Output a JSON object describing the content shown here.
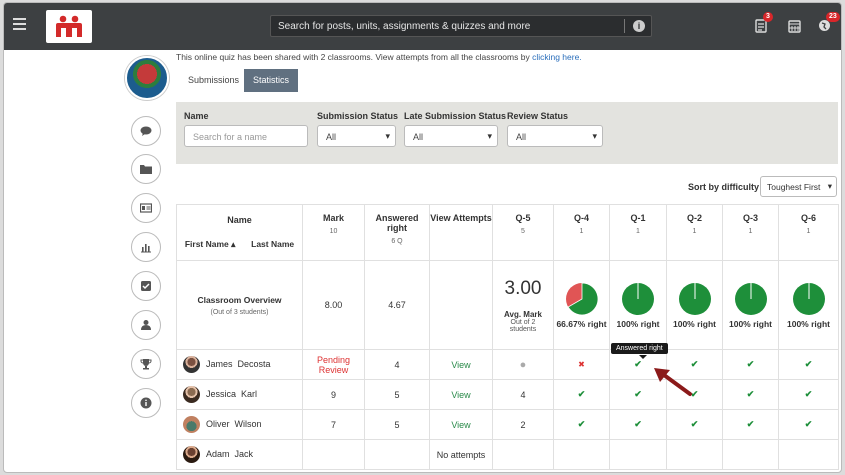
{
  "header": {
    "search_placeholder": "Search for posts, units, assignments & quizzes and more",
    "badges": {
      "notes": "3",
      "notifications": "23"
    }
  },
  "share_text": "This online quiz has been shared with 2 classrooms. View attempts from all the classrooms by ",
  "share_link": "clicking here.",
  "tabs": [
    "Submissions",
    "Statistics"
  ],
  "filters": {
    "name_label": "Name",
    "name_placeholder": "Search for a name",
    "submission_label": "Submission Status",
    "submission_value": "All",
    "late_label": "Late Submission Status",
    "late_value": "All",
    "review_label": "Review Status",
    "review_value": "All"
  },
  "sort": {
    "label": "Sort by difficulty",
    "value": "Toughest First"
  },
  "table": {
    "name_header": "Name",
    "first_name": "First Name",
    "last_name": "Last Name",
    "mark_header": "Mark",
    "mark_sub": "10",
    "answered_header": "Answered right",
    "answered_sub": "6 Q",
    "view_header": "View Attempts",
    "questions": [
      {
        "label": "Q-5",
        "sub": "5"
      },
      {
        "label": "Q-4",
        "sub": "1"
      },
      {
        "label": "Q-1",
        "sub": "1"
      },
      {
        "label": "Q-2",
        "sub": "1"
      },
      {
        "label": "Q-3",
        "sub": "1"
      },
      {
        "label": "Q-6",
        "sub": "1"
      }
    ],
    "overview": {
      "title": "Classroom Overview",
      "subtitle": "(Out of 3 students)",
      "mark": "8.00",
      "answered": "4.67",
      "avg_value": "3.00",
      "avg_label": "Avg. Mark",
      "avg_sub": "Out of 2 students",
      "pies": [
        {
          "label": "66.67% right",
          "pct": 66.67
        },
        {
          "label": "100% right",
          "pct": 100
        },
        {
          "label": "100% right",
          "pct": 100
        },
        {
          "label": "100% right",
          "pct": 100
        },
        {
          "label": "100% right",
          "pct": 100
        }
      ]
    },
    "rows": [
      {
        "first": "James",
        "last": "Decosta",
        "mark": "Pending Review",
        "answered": "4",
        "view": "View",
        "q5": "●",
        "marks": [
          "✖",
          "✔",
          "✔",
          "✔",
          "✔"
        ]
      },
      {
        "first": "Jessica",
        "last": "Karl",
        "mark": "9",
        "answered": "5",
        "view": "View",
        "q5": "4",
        "marks": [
          "✔",
          "✔",
          "✔",
          "✔",
          "✔"
        ]
      },
      {
        "first": "Oliver",
        "last": "Wilson",
        "mark": "7",
        "answered": "5",
        "view": "View",
        "q5": "2",
        "marks": [
          "✔",
          "✔",
          "✔",
          "✔",
          "✔"
        ]
      },
      {
        "first": "Adam",
        "last": "Jack",
        "mark": "",
        "answered": "",
        "view": "No attempts",
        "q5": "",
        "marks": [
          "",
          "",
          "",
          "",
          ""
        ]
      }
    ]
  },
  "tooltip": "Answered right",
  "colors": {
    "green": "#1e8f3a",
    "red": "#e05555",
    "accent": "#607080"
  }
}
